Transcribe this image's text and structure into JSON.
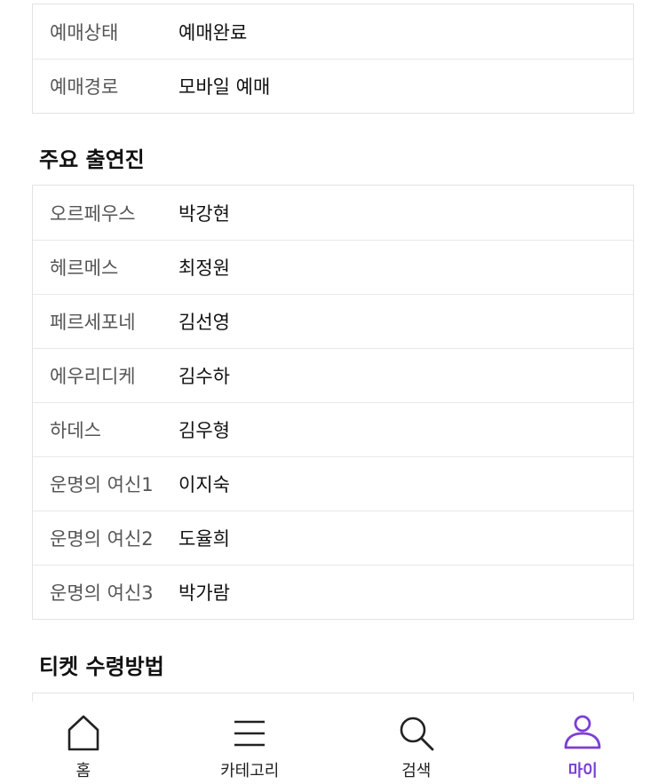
{
  "booking_info": [
    {
      "label": "예매상태",
      "value": "예매완료"
    },
    {
      "label": "예매경로",
      "value": "모바일 예매"
    }
  ],
  "cast_section": {
    "title": "주요 출연진",
    "rows": [
      {
        "label": "오르페우스",
        "value": "박강현"
      },
      {
        "label": "헤르메스",
        "value": "최정원"
      },
      {
        "label": "페르세포네",
        "value": "김선영"
      },
      {
        "label": "에우리디케",
        "value": "김수하"
      },
      {
        "label": "하데스",
        "value": "김우형"
      },
      {
        "label": "운명의 여신1",
        "value": "이지숙"
      },
      {
        "label": "운명의 여신2",
        "value": "도율희"
      },
      {
        "label": "운명의 여신3",
        "value": "박가람"
      }
    ]
  },
  "ticket_section": {
    "title": "티켓 수령방법"
  },
  "bottom_nav": {
    "items": [
      {
        "label": "홈",
        "icon": "home-icon"
      },
      {
        "label": "카테고리",
        "icon": "menu-icon"
      },
      {
        "label": "검색",
        "icon": "search-icon"
      },
      {
        "label": "마이",
        "icon": "user-icon",
        "active": true
      }
    ],
    "active_color": "#7b3fd4"
  }
}
